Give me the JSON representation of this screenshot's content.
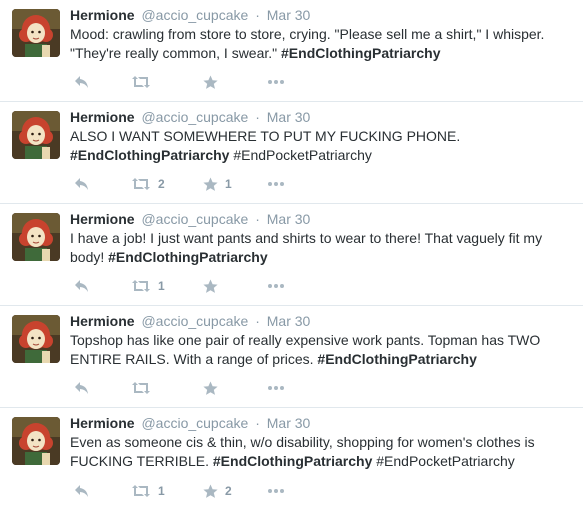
{
  "icons": {
    "reply": "reply-icon",
    "retweet": "retweet-icon",
    "favorite": "star-icon",
    "more": "more-dots-icon"
  },
  "colors": {
    "text": "#292f33",
    "muted": "#8899a6",
    "icon": "#aab8c2",
    "divider": "#e1e8ed"
  },
  "tweets": [
    {
      "name": "Hermione",
      "handle": "@accio_cupcake",
      "sep": "·",
      "time": "Mar 30",
      "text_parts": [
        {
          "text": "Mood: crawling from store to store, crying. \"Please sell me a shirt,\" I whisper. \"They're really common, I swear.\" "
        },
        {
          "text": "#EndClothingPatriarchy"
        }
      ],
      "retweets": "",
      "favorites": ""
    },
    {
      "name": "Hermione",
      "handle": "@accio_cupcake",
      "sep": "·",
      "time": "Mar 30",
      "text_parts": [
        {
          "text": "ALSO I WANT SOMEWHERE TO PUT MY FUCKING PHONE. "
        },
        {
          "text": "#EndClothingPatriarchy"
        },
        {
          "text": " "
        },
        {
          "text": "#EndPocketPatriarchy"
        }
      ],
      "retweets": "2",
      "favorites": "1"
    },
    {
      "name": "Hermione",
      "handle": "@accio_cupcake",
      "sep": "·",
      "time": "Mar 30",
      "text_parts": [
        {
          "text": "I have a job! I just want pants and shirts to wear to there! That vaguely fit my body! "
        },
        {
          "text": "#EndClothingPatriarchy"
        }
      ],
      "retweets": "1",
      "favorites": ""
    },
    {
      "name": "Hermione",
      "handle": "@accio_cupcake",
      "sep": "·",
      "time": "Mar 30",
      "text_parts": [
        {
          "text": "Topshop has like one pair of really expensive work pants. Topman has TWO ENTIRE RAILS. With a range of prices. "
        },
        {
          "text": "#EndClothingPatriarchy"
        }
      ],
      "retweets": "",
      "favorites": ""
    },
    {
      "name": "Hermione",
      "handle": "@accio_cupcake",
      "sep": "·",
      "time": "Mar 30",
      "text_parts": [
        {
          "text": "Even as someone cis & thin, w/o disability, shopping for women's clothes is FUCKING TERRIBLE. "
        },
        {
          "text": "#EndClothingPatriarchy"
        },
        {
          "text": " "
        },
        {
          "text": "#EndPocketPatriarchy"
        }
      ],
      "retweets": "1",
      "favorites": "2"
    }
  ]
}
